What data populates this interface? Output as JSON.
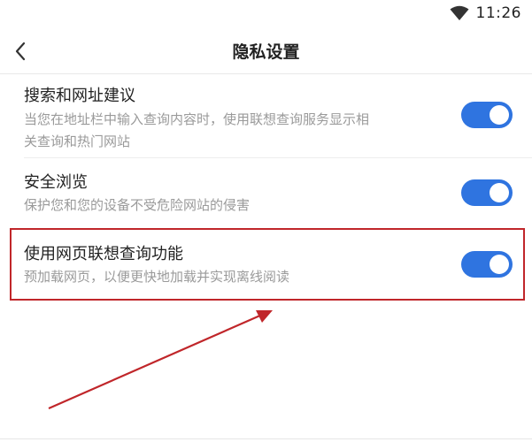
{
  "status_bar": {
    "time": "11:26",
    "icons": [
      "wifi-icon"
    ]
  },
  "header": {
    "title": "隐私设置",
    "back_icon": "chevron-left-icon"
  },
  "settings": [
    {
      "title": "搜索和网址建议",
      "description_lines": [
        "当您在地址栏中输入查询内容时，使用联想查询服务显示相",
        "关查询和热门网站"
      ],
      "enabled": true
    },
    {
      "title": "安全浏览",
      "description_lines": [
        "保护您和您的设备不受危险网站的侵害"
      ],
      "enabled": true
    },
    {
      "title": "使用网页联想查询功能",
      "description_lines": [
        "预加载网页，以便更快地加载并实现离线阅读"
      ],
      "enabled": true,
      "highlighted": true
    }
  ],
  "colors": {
    "toggle_on": "#2f74e0",
    "highlight": "#c0262a",
    "arrow": "#c0262a"
  }
}
